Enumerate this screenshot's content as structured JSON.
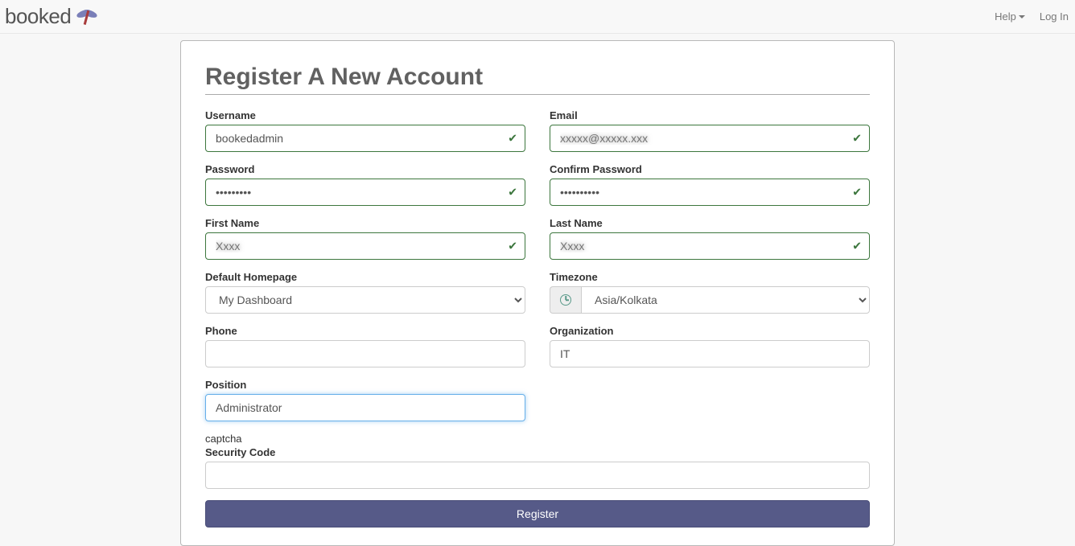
{
  "brand": {
    "name": "booked"
  },
  "nav": {
    "help": "Help",
    "login": "Log In"
  },
  "page": {
    "title": "Register A New Account"
  },
  "form": {
    "username": {
      "label": "Username",
      "value": "bookedadmin",
      "valid": true
    },
    "email": {
      "label": "Email",
      "value": "",
      "valid": true,
      "blurred": "xxxxx@xxxxx.xxx"
    },
    "password": {
      "label": "Password",
      "value": "•••••••••",
      "valid": true
    },
    "confirm_password": {
      "label": "Confirm Password",
      "value": "••••••••••",
      "valid": true
    },
    "first_name": {
      "label": "First Name",
      "value": "",
      "valid": true,
      "blurred": "Xxxx"
    },
    "last_name": {
      "label": "Last Name",
      "value": "",
      "valid": true,
      "blurred": "Xxxx"
    },
    "homepage": {
      "label": "Default Homepage",
      "value": "My Dashboard"
    },
    "timezone": {
      "label": "Timezone",
      "value": "Asia/Kolkata"
    },
    "phone": {
      "label": "Phone",
      "value": ""
    },
    "organization": {
      "label": "Organization",
      "value": "IT"
    },
    "position": {
      "label": "Position",
      "value": "Administrator"
    },
    "captcha_text": "captcha",
    "security_code": {
      "label": "Security Code",
      "value": ""
    },
    "register_button": "Register"
  }
}
